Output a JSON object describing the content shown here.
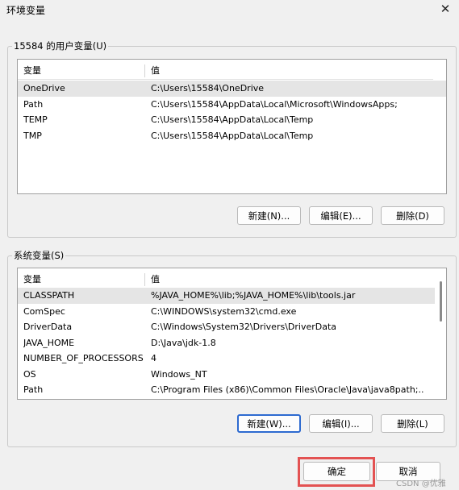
{
  "window": {
    "title": "环境变量",
    "close_icon": "close-icon"
  },
  "user_vars": {
    "group_label": "15584 的用户变量(U)",
    "headers": {
      "name": "变量",
      "value": "值"
    },
    "rows": [
      {
        "name": "OneDrive",
        "value": "C:\\Users\\15584\\OneDrive"
      },
      {
        "name": "Path",
        "value": "C:\\Users\\15584\\AppData\\Local\\Microsoft\\WindowsApps;"
      },
      {
        "name": "TEMP",
        "value": "C:\\Users\\15584\\AppData\\Local\\Temp"
      },
      {
        "name": "TMP",
        "value": "C:\\Users\\15584\\AppData\\Local\\Temp"
      }
    ],
    "buttons": {
      "new": "新建(N)...",
      "edit": "编辑(E)...",
      "delete": "删除(D)"
    }
  },
  "system_vars": {
    "group_label": "系统变量(S)",
    "headers": {
      "name": "变量",
      "value": "值"
    },
    "rows": [
      {
        "name": "CLASSPATH",
        "value": "%JAVA_HOME%\\lib;%JAVA_HOME%\\lib\\tools.jar"
      },
      {
        "name": "ComSpec",
        "value": "C:\\WINDOWS\\system32\\cmd.exe"
      },
      {
        "name": "DriverData",
        "value": "C:\\Windows\\System32\\Drivers\\DriverData"
      },
      {
        "name": "JAVA_HOME",
        "value": "D:\\Java\\jdk-1.8"
      },
      {
        "name": "NUMBER_OF_PROCESSORS",
        "value": "4"
      },
      {
        "name": "OS",
        "value": "Windows_NT"
      },
      {
        "name": "Path",
        "value": "C:\\Program Files (x86)\\Common Files\\Oracle\\Java\\java8path;..."
      }
    ],
    "buttons": {
      "new": "新建(W)...",
      "edit": "编辑(I)...",
      "delete": "删除(L)"
    }
  },
  "footer": {
    "ok": "确定",
    "cancel": "取消",
    "highlight_color": "#e35252"
  },
  "watermark": "CSDN @优雅"
}
